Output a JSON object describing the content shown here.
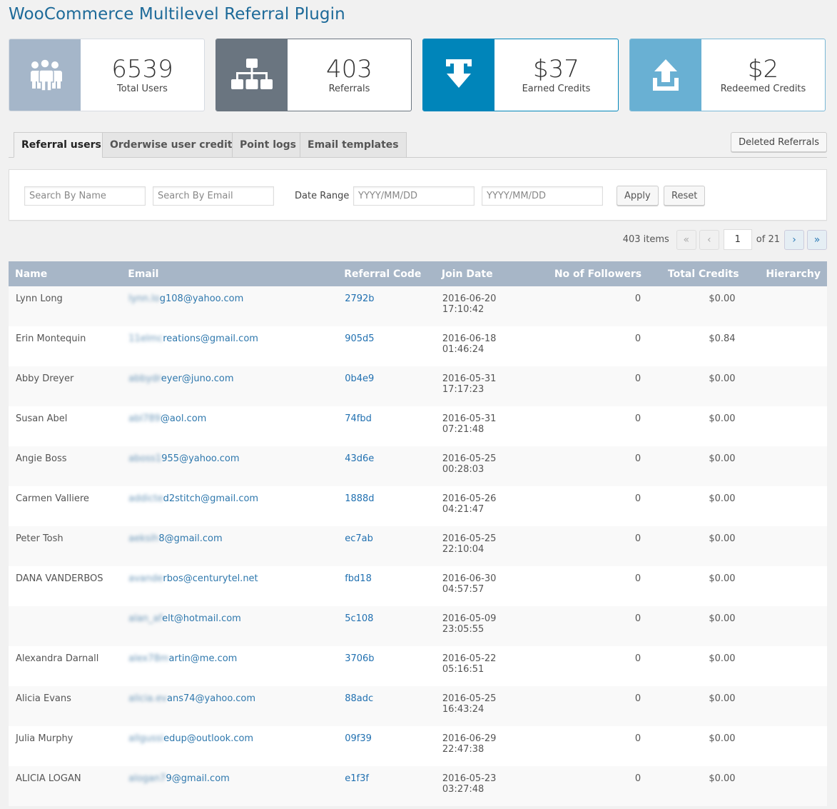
{
  "title": "WooCommerce Multilevel Referral Plugin",
  "stats": [
    {
      "value": "6539",
      "label": "Total Users",
      "icon": "users-icon"
    },
    {
      "value": "403",
      "label": "Referrals",
      "icon": "sitemap-icon"
    },
    {
      "value": "$37",
      "label": "Earned Credits",
      "icon": "download-arrow-icon"
    },
    {
      "value": "$2",
      "label": "Redeemed Credits",
      "icon": "upload-icon"
    }
  ],
  "tabs": [
    "Referral users",
    "Orderwise user credits",
    "Point logs",
    "Email templates"
  ],
  "deleted_label": "Deleted Referrals",
  "filters": {
    "name_placeholder": "Search By Name",
    "email_placeholder": "Search By Email",
    "date_label": "Date Range :",
    "date_from_placeholder": "YYYY/MM/DD",
    "date_to_placeholder": "YYYY/MM/DD",
    "apply": "Apply",
    "reset": "Reset"
  },
  "pagination": {
    "items": "403 items",
    "first": "«",
    "prev": "‹",
    "page": "1",
    "of": "of 21",
    "next": "›",
    "last": "»"
  },
  "columns": [
    "Name",
    "Email",
    "Referral Code",
    "Join Date",
    "No of Followers",
    "Total Credits",
    "Hierarchy"
  ],
  "rows": [
    {
      "name": "Lynn Long",
      "email_hidden": "lynn.lo",
      "email": "g108@yahoo.com",
      "code": "2792b",
      "date": "2016-06-20 17:10:42",
      "followers": "0",
      "credits": "$0.00"
    },
    {
      "name": "Erin Montequin",
      "email_hidden": "11elmc",
      "email": "reations@gmail.com",
      "code": "905d5",
      "date": "2016-06-18 01:46:24",
      "followers": "0",
      "credits": "$0.84"
    },
    {
      "name": "Abby Dreyer",
      "email_hidden": "abbydr",
      "email": "eyer@juno.com",
      "code": "0b4e9",
      "date": "2016-05-31 17:17:23",
      "followers": "0",
      "credits": "$0.00"
    },
    {
      "name": "Susan Abel",
      "email_hidden": "abl789",
      "email": "@aol.com",
      "code": "74fbd",
      "date": "2016-05-31 07:21:48",
      "followers": "0",
      "credits": "$0.00"
    },
    {
      "name": "Angie Boss",
      "email_hidden": "aboss1",
      "email": "955@yahoo.com",
      "code": "43d6e",
      "date": "2016-05-25 00:28:03",
      "followers": "0",
      "credits": "$0.00"
    },
    {
      "name": "Carmen Valliere",
      "email_hidden": "addicte",
      "email": "d2stitch@gmail.com",
      "code": "1888d",
      "date": "2016-05-26 04:21:47",
      "followers": "0",
      "credits": "$0.00"
    },
    {
      "name": "Peter Tosh",
      "email_hidden": "aeksih",
      "email": "8@gmail.com",
      "code": "ec7ab",
      "date": "2016-05-25 22:10:04",
      "followers": "0",
      "credits": "$0.00"
    },
    {
      "name": "DANA VANDERBOS",
      "email_hidden": "avande",
      "email": "rbos@centurytel.net",
      "code": "fbd18",
      "date": "2016-06-30 04:57:57",
      "followers": "0",
      "credits": "$0.00"
    },
    {
      "name": "",
      "email_hidden": "alan_af",
      "email": "elt@hotmail.com",
      "code": "5c108",
      "date": "2016-05-09 23:05:55",
      "followers": "0",
      "credits": "$0.00"
    },
    {
      "name": "Alexandra Darnall",
      "email_hidden": "alex78m",
      "email": "artin@me.com",
      "code": "3706b",
      "date": "2016-05-22 05:16:51",
      "followers": "0",
      "credits": "$0.00"
    },
    {
      "name": "Alicia Evans",
      "email_hidden": "alicia.ev",
      "email": "ans74@yahoo.com",
      "code": "88adc",
      "date": "2016-05-25 16:43:24",
      "followers": "0",
      "credits": "$0.00"
    },
    {
      "name": "Julia Murphy",
      "email_hidden": "allgussi",
      "email": "edup@outlook.com",
      "code": "09f39",
      "date": "2016-06-29 22:47:38",
      "followers": "0",
      "credits": "$0.00"
    },
    {
      "name": "ALICIA LOGAN",
      "email_hidden": "alogan7",
      "email": "9@gmail.com",
      "code": "e1f3f",
      "date": "2016-05-23 03:27:48",
      "followers": "0",
      "credits": "$0.00"
    }
  ]
}
